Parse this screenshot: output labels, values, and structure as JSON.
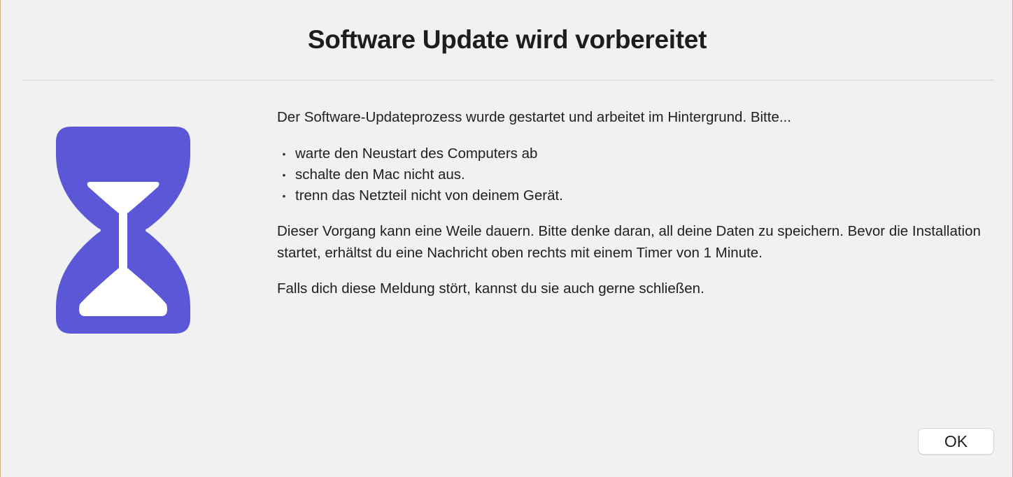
{
  "dialog": {
    "title": "Software Update wird vorbereitet",
    "icon": "hourglass-icon",
    "accent_color": "#5a58d6",
    "intro": "Der Software-Updateprozess wurde gestartet und arbeitet im Hintergrund. Bitte...",
    "bullets": [
      "warte den Neustart des Computers ab",
      "schalte den Mac nicht aus.",
      "trenn das Netzteil nicht von deinem Gerät."
    ],
    "paragraph_2": "Dieser Vorgang kann eine Weile dauern. Bitte denke daran, all deine Daten zu speichern. Bevor die Installation startet, erhältst du eine Nachricht oben rechts mit einem Timer von 1 Minute.",
    "paragraph_3": "Falls dich diese Meldung stört, kannst du sie auch gerne schließen.",
    "ok_label": "OK"
  }
}
